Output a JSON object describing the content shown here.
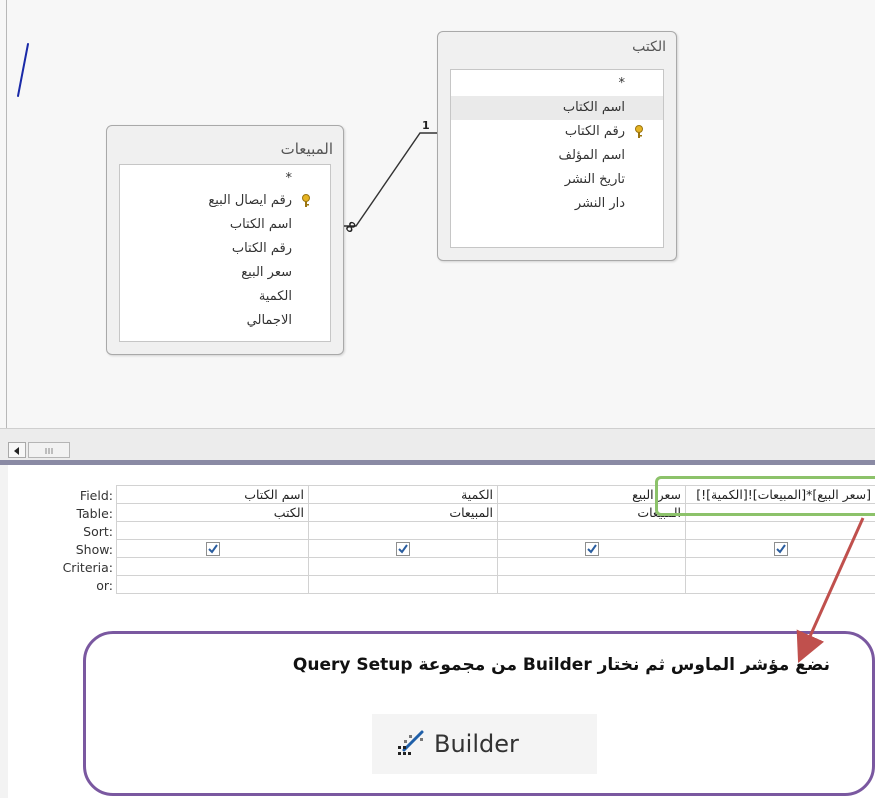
{
  "design_pane": {
    "tables": [
      {
        "name": "الكتب",
        "fields": [
          {
            "label": "*",
            "key": false,
            "selected": false
          },
          {
            "label": "اسم الكتاب",
            "key": false,
            "selected": true
          },
          {
            "label": "رقم الكتاب",
            "key": true,
            "selected": false
          },
          {
            "label": "اسم المؤلف",
            "key": false,
            "selected": false
          },
          {
            "label": "تاريخ النشر",
            "key": false,
            "selected": false
          },
          {
            "label": "دار النشر",
            "key": false,
            "selected": false
          }
        ]
      },
      {
        "name": "المبيعات",
        "fields": [
          {
            "label": "*",
            "key": false,
            "selected": false
          },
          {
            "label": "رقم ايصال البيع",
            "key": true,
            "selected": false
          },
          {
            "label": "اسم الكتاب",
            "key": false,
            "selected": false
          },
          {
            "label": "رقم الكتاب",
            "key": false,
            "selected": false
          },
          {
            "label": "سعر البيع",
            "key": false,
            "selected": false
          },
          {
            "label": "الكمية",
            "key": false,
            "selected": false
          },
          {
            "label": "الاجمالي",
            "key": false,
            "selected": false
          }
        ]
      }
    ],
    "relationship": {
      "one_side": "1",
      "many_side": "∞"
    }
  },
  "scrollbar": {
    "left_arrow": "◀",
    "thumb": "|||"
  },
  "query_grid": {
    "row_labels": [
      "Field:",
      "Table:",
      "Sort:",
      "Show:",
      "Criteria:",
      "or:"
    ],
    "columns": [
      {
        "field": "اسم الكتاب",
        "table": "الكتب",
        "show": true
      },
      {
        "field": "الكمية",
        "table": "المبيعات",
        "show": true
      },
      {
        "field": "سعر البيع",
        "table": "المبيعات",
        "show": true
      },
      {
        "field": "[سعر البيع]*[المبيعات]![الكمية]!]",
        "table": "",
        "show": true
      }
    ]
  },
  "callout": {
    "instruction": "نضع مؤشر الماوس ثم نختار Builder من مجموعة Query Setup",
    "builder_label": "Builder"
  },
  "colors": {
    "highlight": "#8cc26a",
    "callout_border": "#7a58a0",
    "arrow": "#c0504d",
    "splitter": "#8a8aa4"
  }
}
